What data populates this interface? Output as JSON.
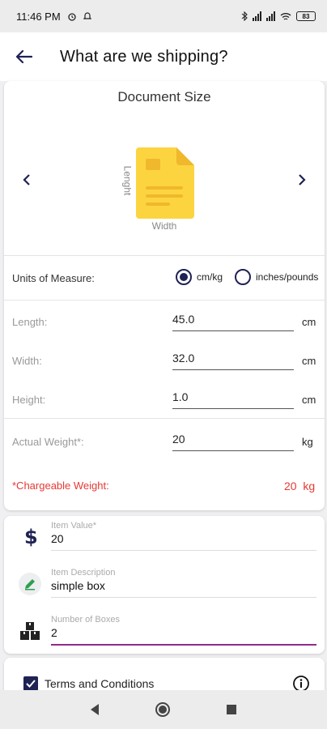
{
  "status_bar": {
    "time": "11:46 PM",
    "battery": "83"
  },
  "app_bar": {
    "title": "What are we shipping?"
  },
  "document": {
    "title": "Document Size",
    "length_axis_label": "Lenght",
    "width_axis_label": "Width",
    "icon": "document-icon"
  },
  "units": {
    "label": "Units of Measure:",
    "options": [
      "cm/kg",
      "inches/pounds"
    ],
    "selected": "cm/kg"
  },
  "fields": {
    "length": {
      "label": "Length:",
      "value": "45.0",
      "unit": "cm"
    },
    "width": {
      "label": "Width:",
      "value": "32.0",
      "unit": "cm"
    },
    "height": {
      "label": "Height:",
      "value": "1.0",
      "unit": "cm"
    },
    "weight": {
      "label": "Actual Weight*:",
      "value": "20",
      "unit": "kg"
    }
  },
  "chargeable": {
    "label": "*Chargeable Weight:",
    "value": "20",
    "unit": "kg"
  },
  "item": {
    "value_label": "Item Value*",
    "value": "20",
    "description_label": "Item Description",
    "description": "simple box",
    "boxes_label": "Number of Boxes",
    "boxes": "2"
  },
  "terms": {
    "label": "Terms and Conditions",
    "checked": true
  },
  "colors": {
    "primary": "#1f2253",
    "doc_yellow": "#fcd440",
    "error": "#e53935",
    "focus": "#8e2c8c"
  }
}
